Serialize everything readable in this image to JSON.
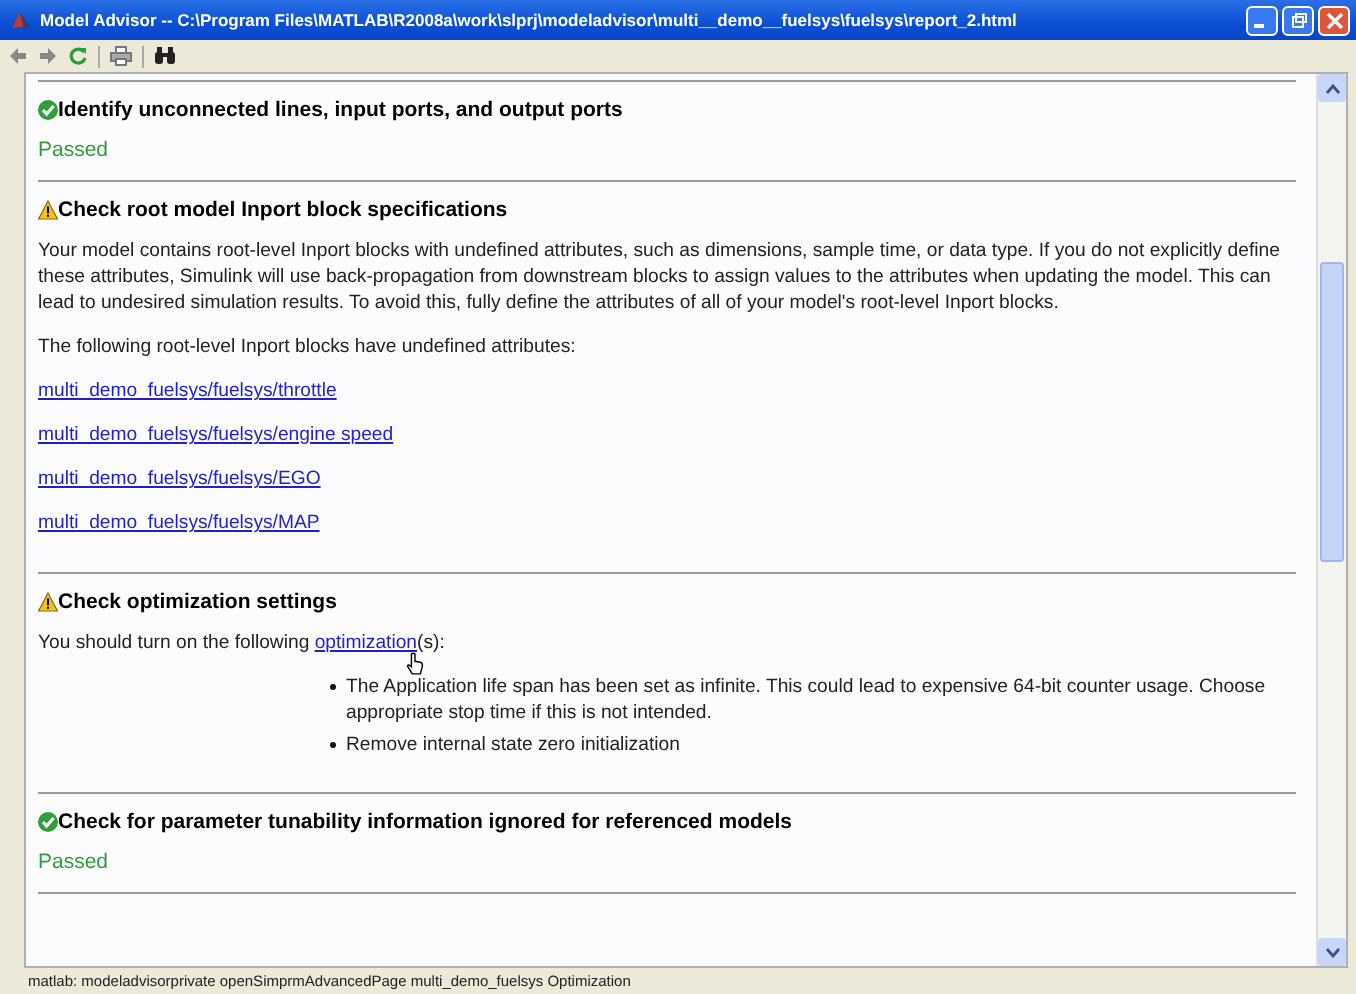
{
  "window": {
    "title": "Model Advisor -- C:\\Program Files\\MATLAB\\R2008a\\work\\slprj\\modeladvisor\\multi__demo__fuelsys\\fuelsys\\report_2.html"
  },
  "sections": [
    {
      "kind": "passed",
      "title": "Identify unconnected lines, input ports, and output ports",
      "blocks": [
        {
          "kind": "result",
          "text": "Passed"
        }
      ]
    },
    {
      "kind": "warning",
      "title": "Check root model Inport block specifications",
      "blocks": [
        {
          "kind": "paragraph",
          "text": "Your model contains root-level Inport blocks with undefined attributes, such as dimensions, sample time, or data type. If you do not explicitly define these attributes, Simulink will use back-propagation from downstream blocks to assign values to the attributes when updating the model. This can lead to undesired simulation results. To avoid this, fully define the attributes of all of your model's root-level Inport blocks."
        },
        {
          "kind": "paragraph",
          "text": "The following root-level Inport blocks have undefined attributes:"
        },
        {
          "kind": "link",
          "text": "multi_demo_fuelsys/fuelsys/throttle"
        },
        {
          "kind": "link",
          "text": "multi_demo_fuelsys/fuelsys/engine speed"
        },
        {
          "kind": "link",
          "text": "multi_demo_fuelsys/fuelsys/EGO"
        },
        {
          "kind": "link",
          "text": "multi_demo_fuelsys/fuelsys/MAP"
        }
      ]
    },
    {
      "kind": "warning",
      "title": "Check optimization settings",
      "blocks": [
        {
          "kind": "link_sentence",
          "before": "You should turn on the following ",
          "link": "optimization",
          "after": "(s):"
        },
        {
          "kind": "bullets",
          "items": [
            "The Application life span has been set as infinite. This could lead to expensive 64-bit counter usage. Choose appropriate stop time if this is not intended.",
            "Remove internal state zero initialization"
          ]
        }
      ]
    },
    {
      "kind": "passed",
      "title": "Check for parameter tunability information ignored for referenced models",
      "blocks": [
        {
          "kind": "result",
          "text": "Passed"
        }
      ]
    }
  ],
  "status_bar": "matlab: modeladvisorprivate openSimprmAdvancedPage multi_demo_fuelsys Optimization"
}
